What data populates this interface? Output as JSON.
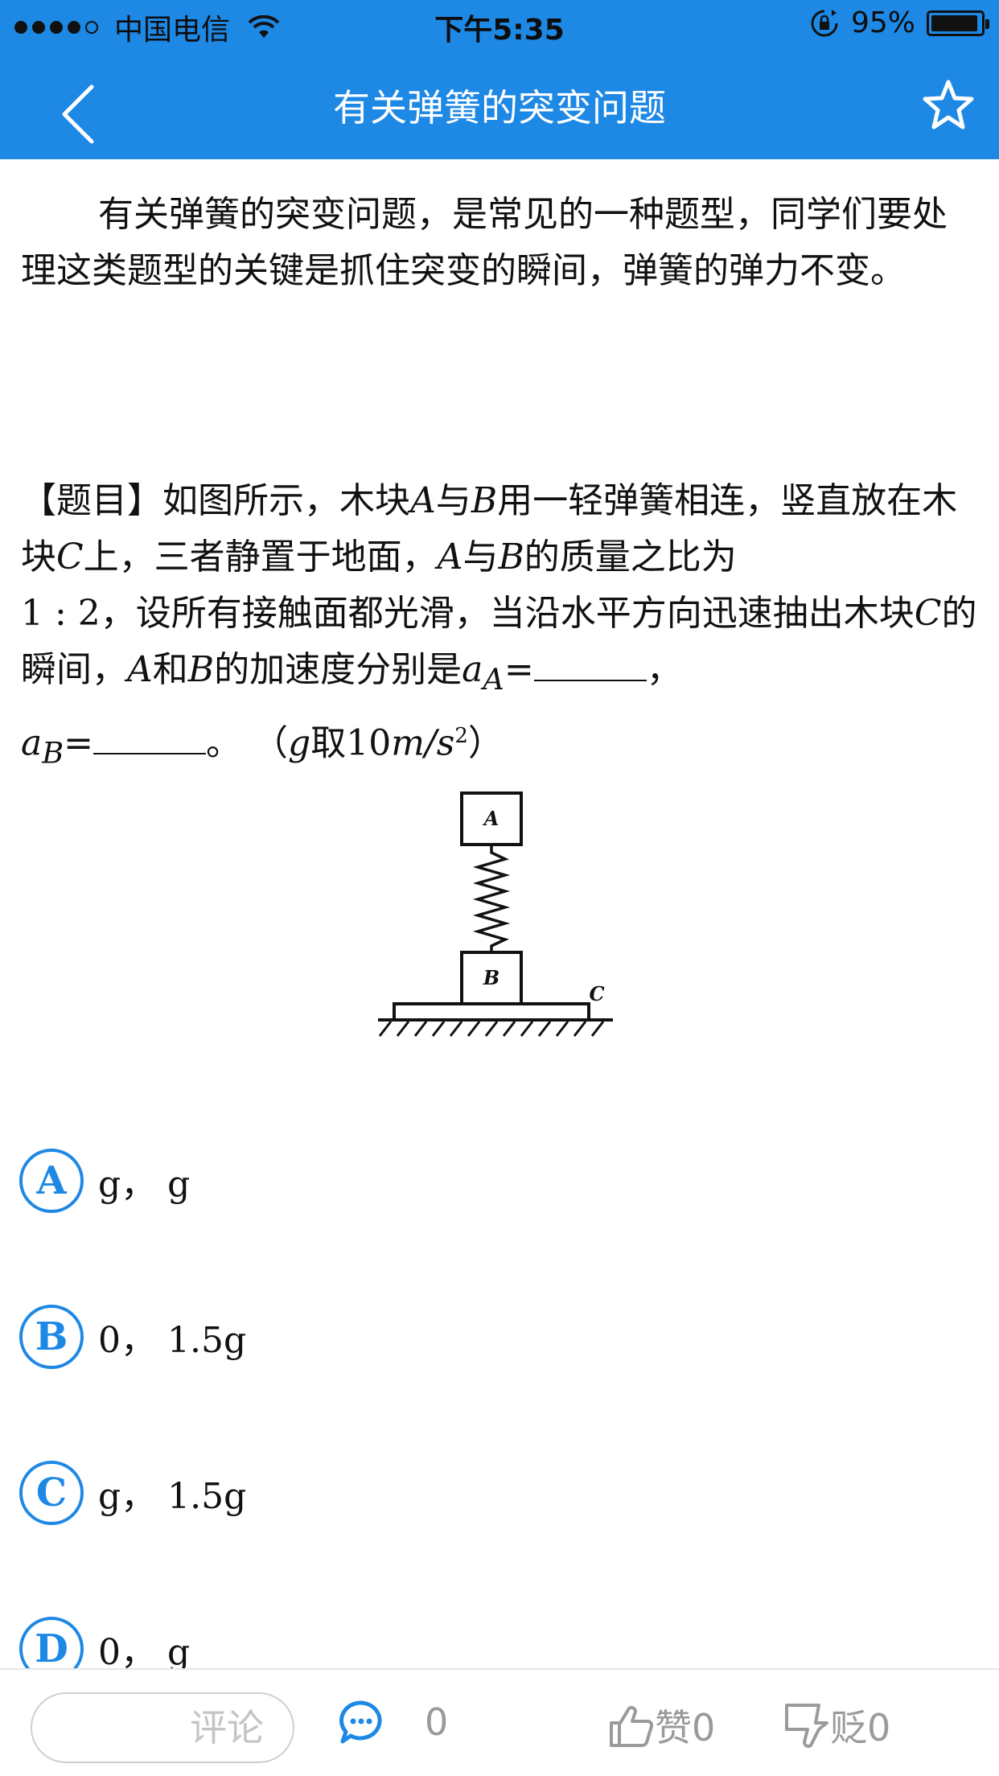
{
  "status_bar": {
    "carrier": "中国电信",
    "time": "下午5:35",
    "battery": "95%",
    "battery_level": 0.95,
    "signal_bars": 4,
    "icons": [
      "signal-icon",
      "wifi-icon",
      "rotation-lock-icon",
      "battery-icon"
    ]
  },
  "nav": {
    "title": "有关弹簧的突变问题",
    "back_icon": "back-chevron-icon",
    "star_icon": "star-outline-icon"
  },
  "article": {
    "intro": "有关弹簧的突变问题，是常见的一种题型，同学们要处理这类题型的关键是抓住突变的瞬间，弹簧的弹力不变。",
    "question": {
      "t1": "【题目】如图所示，木块",
      "A": "A",
      "t2": "与",
      "B": "B",
      "t3": "用一轻弹簧相连，竖直放在木块",
      "C": "C",
      "t4": "上，三者静置于地面，",
      "t5": "的质量之比为",
      "ratio": "1 : 2",
      "t6": "，设所有接触面都光滑，当沿水平方向迅速抽出木块",
      "t7": "的瞬间，",
      "t8": "和",
      "t9": "的加速度分别是",
      "aA": "a",
      "aA_sub": "A",
      "eq": "=",
      "comma": "，",
      "aB": "a",
      "aB_sub": "B",
      "end": "。",
      "note_open": "（",
      "g": "g",
      "note_take": "取",
      "note_value": "10",
      "m": "m",
      "slash": "/",
      "s": "s",
      "sq": "2",
      "note_close": "）"
    },
    "figure": {
      "label_A": "A",
      "label_B": "B",
      "label_C": "C"
    }
  },
  "options": [
    {
      "letter": "A",
      "text": "g， g"
    },
    {
      "letter": "B",
      "text": "0， 1.5g"
    },
    {
      "letter": "C",
      "text": "g， 1.5g"
    },
    {
      "letter": "D",
      "text": "0， g"
    }
  ],
  "bottom_bar": {
    "comment_placeholder": "评论",
    "comment_count": "0",
    "like_label": "赞0",
    "dislike_label": "贬0",
    "icons": [
      "comment-bubble-icon",
      "thumbs-up-icon",
      "thumbs-down-icon"
    ]
  },
  "colors": {
    "primary": "#1e88e5",
    "muted": "#9a9a9a"
  }
}
